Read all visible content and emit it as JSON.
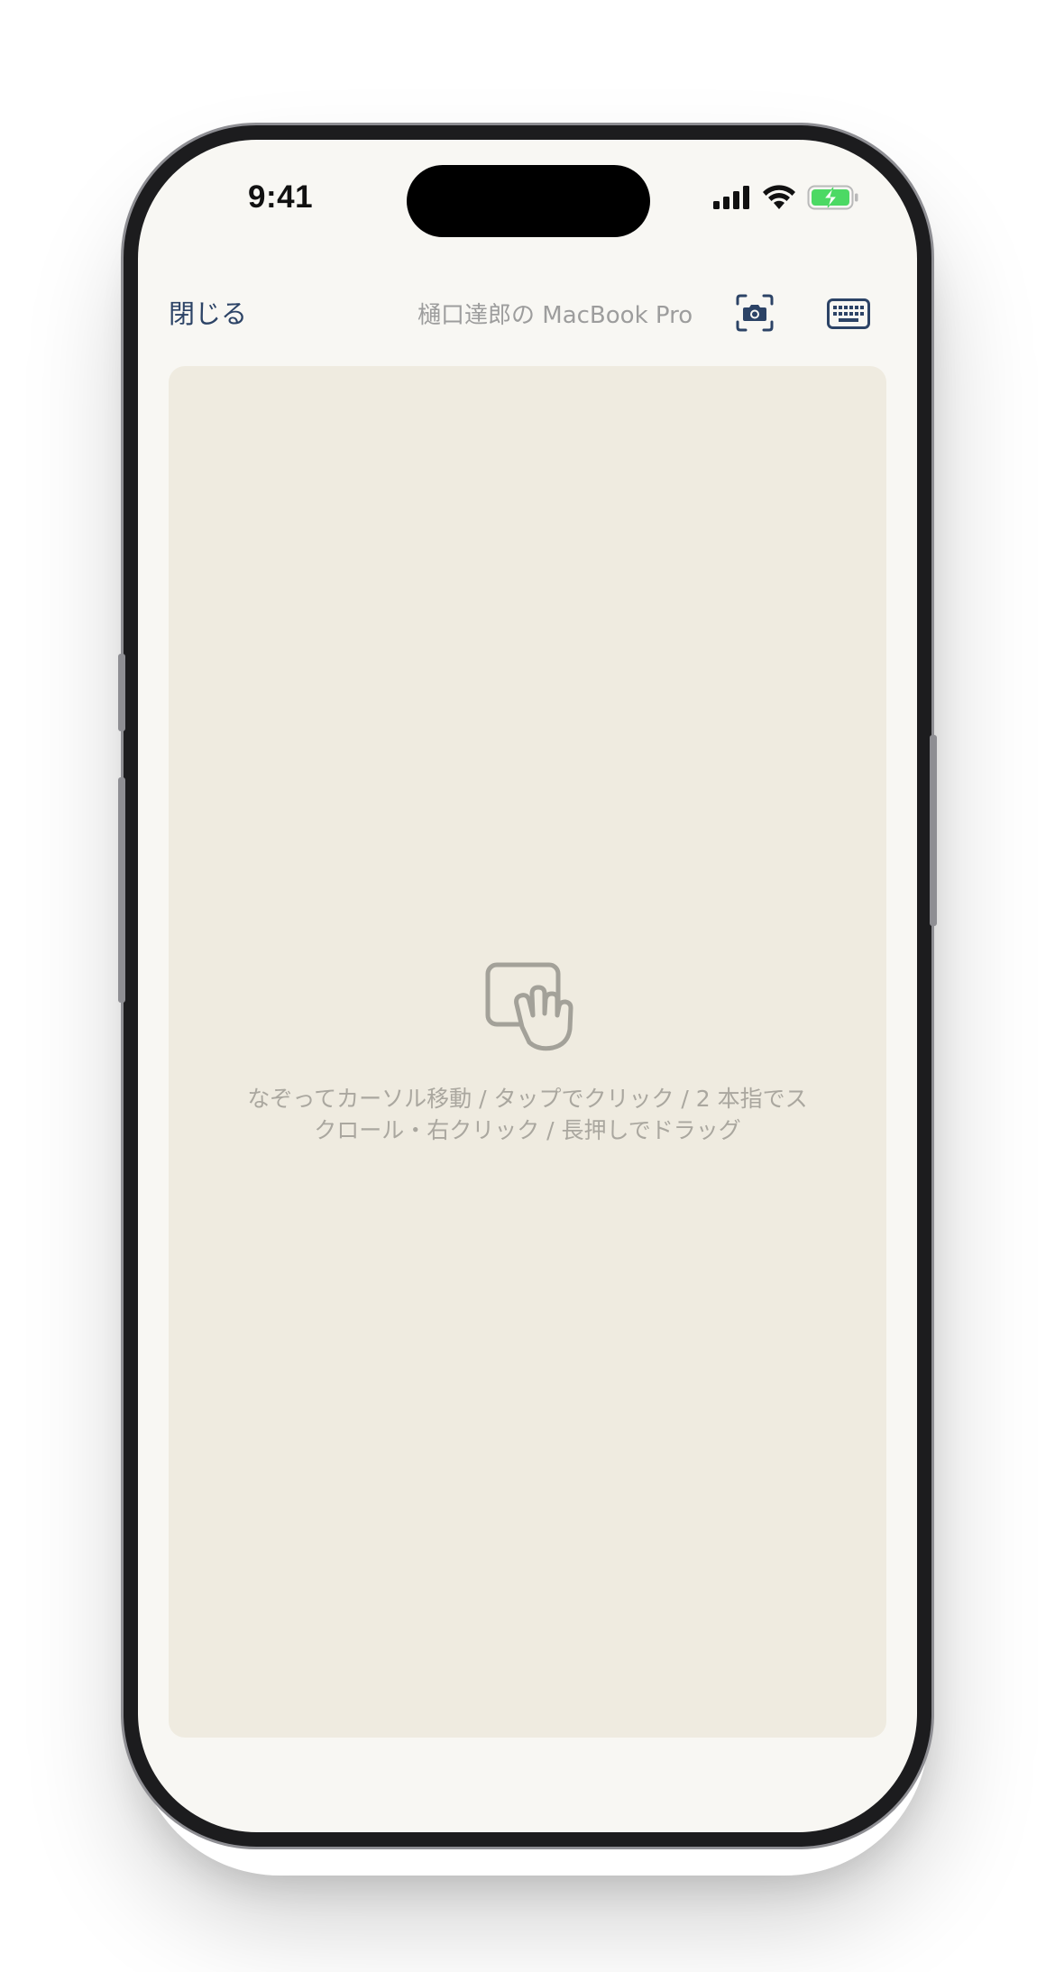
{
  "status_bar": {
    "time": "9:41",
    "icons": [
      "signal-icon",
      "wifi-icon",
      "battery-charging-icon"
    ]
  },
  "nav": {
    "close_label": "閉じる",
    "device_title": "樋口達郎の MacBook Pro",
    "camera_icon": "camera-icon",
    "keyboard_icon": "keyboard-icon"
  },
  "trackpad": {
    "icon": "trackpad-gesture-icon",
    "hint_line1": "なぞってカーソル移動 / タップでクリック / 2 本指でス",
    "hint_line2": "クロール・右クリック / 長押しでドラッグ"
  },
  "colors": {
    "accent": "#2c4366",
    "screen_bg": "#f8f7f3",
    "trackpad_bg": "#efebe0",
    "muted_text": "#aaa79f",
    "battery_green": "#4cd964"
  }
}
